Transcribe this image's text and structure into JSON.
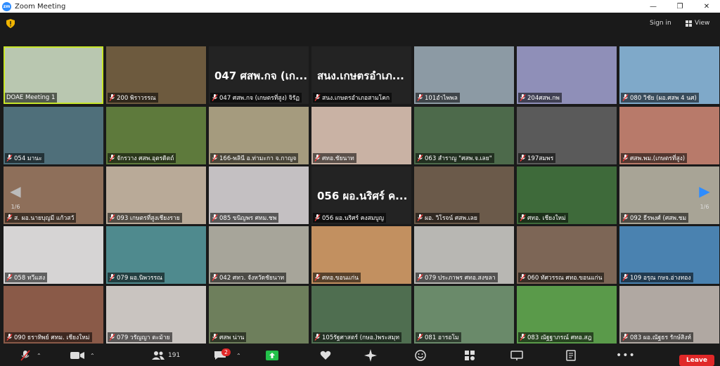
{
  "window": {
    "title": "Zoom Meeting",
    "app_icon_text": "zm",
    "minimize": "—",
    "maximize": "❐",
    "close": "✕"
  },
  "topbar": {
    "signin": "Sign in",
    "view": "View"
  },
  "pagination": {
    "left": "1/6",
    "right": "1/6"
  },
  "toolbar": {
    "participants_count": "191",
    "chat_badge": "2",
    "leave": "Leave"
  },
  "tiles": [
    {
      "name": "DOAE Meeting 1",
      "muted": false,
      "bg": "#b9c7b0",
      "active": true
    },
    {
      "name": "200 พิราวรรณ",
      "muted": true,
      "bg": "#6d5a3e"
    },
    {
      "name": "047 ศสพ.กจ (เกษตรที่สูง) จิรัฏ",
      "muted": true,
      "bg": "#232323",
      "big": "047 ศสพ.กจ (เก..."
    },
    {
      "name": "สนง.เกษตรอำเภอสามโคก",
      "muted": true,
      "bg": "#232323",
      "big": "สนง.เกษตรอำเภ..."
    },
    {
      "name": "101อำไพพล",
      "muted": true,
      "bg": "#8c9aa4"
    },
    {
      "name": "204ศสพ.กพ",
      "muted": true,
      "bg": "#8f8fb8"
    },
    {
      "name": "080 วิชัย (ผอ.ศสพ 4 นศ)",
      "muted": true,
      "bg": "#7fa9c9"
    },
    {
      "name": "054 มานะ",
      "muted": true,
      "bg": "#4f6f7a"
    },
    {
      "name": "จักรวาง ศสพ.อุตรดิตถ์",
      "muted": true,
      "bg": "#5e7a3c"
    },
    {
      "name": "166-พลินี อ.ท่ามะกา จ.กาญจ",
      "muted": true,
      "bg": "#a59b7e"
    },
    {
      "name": "ศทอ.ชัยนาท",
      "muted": true,
      "bg": "#c9b2a4"
    },
    {
      "name": "063 สำราญ \"ศสพ.จ.เลย\"",
      "muted": true,
      "bg": "#4d6a4b"
    },
    {
      "name": "197สมพร",
      "muted": true,
      "bg": "#5a5a5a"
    },
    {
      "name": "ศสพ.พม.(เกษตรที่สูง)",
      "muted": true,
      "bg": "#b87a6a"
    },
    {
      "name": "ส. ผอ.นายบุญมี แก้วสวั",
      "muted": true,
      "bg": "#8e6f5a"
    },
    {
      "name": "093 เกษตรที่สูงเชียงราย",
      "muted": true,
      "bg": "#b9aa98"
    },
    {
      "name": "085 ขนิญพร ศทม.ชพ",
      "muted": true,
      "bg": "#c4c0c2"
    },
    {
      "name": "056 ผอ.นริศร์ คงสมบูญ",
      "muted": true,
      "bg": "#232323",
      "big": "056 ผอ.นริศร์ ค..."
    },
    {
      "name": "ผอ. วิโรจน์ ศสพ.เลย",
      "muted": true,
      "bg": "#6b5a4a"
    },
    {
      "name": "ศทอ. เชียงใหม่",
      "muted": true,
      "bg": "#3e6a3a"
    },
    {
      "name": "092 ธีรพงศ์ (ศสพ.ชม",
      "muted": true,
      "bg": "#a8a496"
    },
    {
      "name": "058 ทวีแสง",
      "muted": true,
      "bg": "#d6d4d4"
    },
    {
      "name": "079 ผอ.นิพวรรณ",
      "muted": true,
      "bg": "#4f8a8e"
    },
    {
      "name": "042 ศทว. จังหวัดชัยนาท",
      "muted": true,
      "bg": "#a7a59a"
    },
    {
      "name": "ศทอ.ขอนแก่น",
      "muted": true,
      "bg": "#c29060"
    },
    {
      "name": "079 ประภาพร ศทอ.สงขลา",
      "muted": true,
      "bg": "#b8b7b3"
    },
    {
      "name": "060 ทัศวรรณ ศทอ.ขอนแก่น",
      "muted": true,
      "bg": "#7d6656"
    },
    {
      "name": "109 อรุณ กษจ.อ่างทอง",
      "muted": true,
      "bg": "#4a82b0"
    },
    {
      "name": "090 ธราทิพย์ ศทม. เชียงใหม่",
      "muted": true,
      "bg": "#8a5a48"
    },
    {
      "name": "079 วรัญญา ตะม้าย",
      "muted": true,
      "bg": "#c9c4c0"
    },
    {
      "name": "ศสพ น่าน",
      "muted": true,
      "bg": "#6e7f5c"
    },
    {
      "name": "105รัฐศาสตร์ (กษอ.)พระสมุท",
      "muted": true,
      "bg": "#4f6e50"
    },
    {
      "name": "081 อารอโม",
      "muted": true,
      "bg": "#6a8a6a"
    },
    {
      "name": "083 ณัฐฐาภรณ์ ศทอ.สฎ",
      "muted": true,
      "bg": "#5a9a4a"
    },
    {
      "name": "083 ผอ.ณัฐธร รักษ์สิงห์",
      "muted": true,
      "bg": "#b0a8a2"
    }
  ]
}
